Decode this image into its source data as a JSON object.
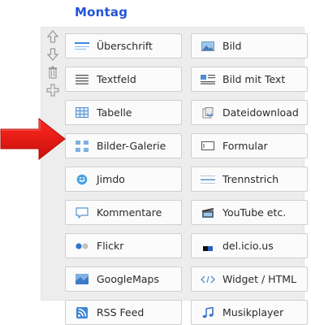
{
  "header": {
    "title": "Montag"
  },
  "side_controls": [
    {
      "icon": "arrow-up-icon"
    },
    {
      "icon": "arrow-down-icon"
    },
    {
      "icon": "trash-icon"
    },
    {
      "icon": "plus-icon"
    }
  ],
  "elements": [
    {
      "label": "Überschrift",
      "icon": "heading-icon"
    },
    {
      "label": "Bild",
      "icon": "image-icon"
    },
    {
      "label": "Textfeld",
      "icon": "text-lines-icon"
    },
    {
      "label": "Bild mit Text",
      "icon": "image-text-icon"
    },
    {
      "label": "Tabelle",
      "icon": "table-icon"
    },
    {
      "label": "Dateidownload",
      "icon": "file-download-icon"
    },
    {
      "label": "Bilder-Galerie",
      "icon": "gallery-icon"
    },
    {
      "label": "Formular",
      "icon": "form-icon"
    },
    {
      "label": "Jimdo",
      "icon": "jimdo-icon"
    },
    {
      "label": "Trennstrich",
      "icon": "divider-icon"
    },
    {
      "label": "Kommentare",
      "icon": "comment-icon"
    },
    {
      "label": "YouTube etc.",
      "icon": "video-icon"
    },
    {
      "label": "Flickr",
      "icon": "flickr-icon"
    },
    {
      "label": "del.icio.us",
      "icon": "delicious-icon"
    },
    {
      "label": "GoogleMaps",
      "icon": "map-icon"
    },
    {
      "label": "Widget / HTML",
      "icon": "code-icon"
    },
    {
      "label": "RSS Feed",
      "icon": "rss-icon"
    },
    {
      "label": "Musikplayer",
      "icon": "music-icon"
    }
  ],
  "colors": {
    "title": "#2455d6",
    "arrow": "#e3201b",
    "panel": "#ededed"
  }
}
